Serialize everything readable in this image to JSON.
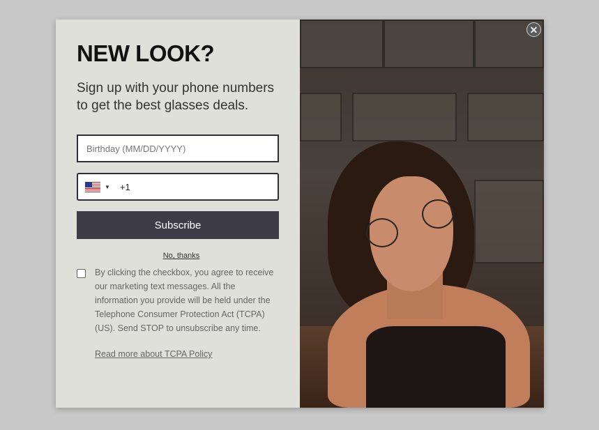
{
  "popup": {
    "headline": "NEW LOOK?",
    "subtext": "Sign up with your phone numbers to get the best glasses deals.",
    "birthday_placeholder": "Birthday (MM/DD/YYYY)",
    "phone_country": "US",
    "phone_dial_code": "+1",
    "subscribe_label": "Subscribe",
    "no_thanks_label": "No, thanks",
    "consent_text": "By clicking the checkbox, you agree to receive our marketing text messages. All the information you provide will be held under the Telephone Consumer Protection Act (TCPA) (US). Send STOP to unsubscribe any time.",
    "tcpa_link_label": "Read more about TCPA Policy",
    "consent_checked": false
  },
  "icons": {
    "close": "close-icon",
    "flag": "us-flag-icon",
    "dropdown": "caret-down-icon"
  },
  "colors": {
    "panel_bg": "#dfe0da",
    "button_bg": "#3d3c47",
    "overlay_bg": "#c8c8c8"
  }
}
